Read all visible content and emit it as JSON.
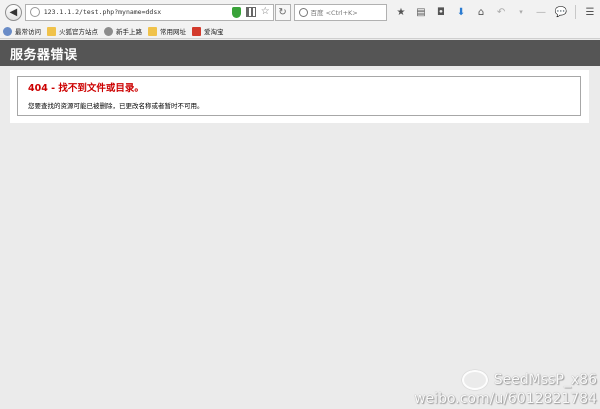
{
  "browser": {
    "url": "123.1.1.2/test.php?myname=ddsx",
    "search_placeholder": "百度 <Ctrl+K>",
    "icons": [
      "back-icon",
      "globe-icon",
      "shield-icon",
      "qr-icon",
      "star-icon",
      "reload-icon",
      "search-icon",
      "bookmark-icon",
      "library-icon",
      "pocket-icon",
      "download-icon",
      "home-icon",
      "undo-icon",
      "chat-icon",
      "menu-icon"
    ]
  },
  "bookmarks": [
    {
      "label": "最常访问",
      "icon": "frequent-icon",
      "color": "#6a8cc7"
    },
    {
      "label": "火狐官方站点",
      "icon": "folder-icon",
      "color": "#f0c24a"
    },
    {
      "label": "新手上路",
      "icon": "gear-icon",
      "color": "#8c8c8c"
    },
    {
      "label": "常用网址",
      "icon": "folder-icon",
      "color": "#f0c24a"
    },
    {
      "label": "爱淘宝",
      "icon": "taobao-icon",
      "color": "#d33a2c"
    }
  ],
  "page": {
    "header_title": "服务器错误",
    "error_title": "404 - 找不到文件或目录。",
    "error_description": "您要查找的资源可能已被删除，已更改名称或者暂时不可用。"
  },
  "watermark": {
    "name": "SeedMssP_x86",
    "url": "weibo.com/u/6012821784"
  },
  "colors": {
    "header_bg": "#555555",
    "error_red": "#cc0000",
    "page_bg": "#ebebeb"
  }
}
